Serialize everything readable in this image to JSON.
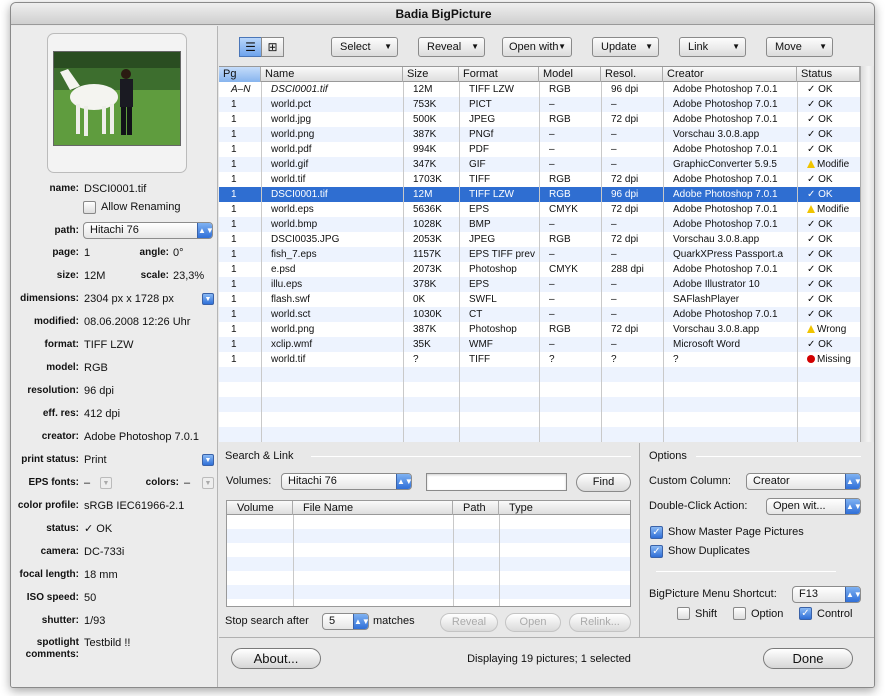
{
  "window": {
    "title": "Badia BigPicture"
  },
  "info": {
    "name_label": "name:",
    "name": "DSCI0001.tif",
    "allow_renaming": "Allow Renaming",
    "path_label": "path:",
    "path": "Hitachi 76",
    "page_label": "page:",
    "page": "1",
    "angle_label": "angle:",
    "angle": "0°",
    "size_label": "size:",
    "size": "12M",
    "scale_label": "scale:",
    "scale": "23,3%",
    "dimensions_label": "dimensions:",
    "dimensions": "2304 px x 1728 px",
    "modified_label": "modified:",
    "modified": "08.06.2008 12:26 Uhr",
    "format_label": "format:",
    "format": "TIFF LZW",
    "model_label": "model:",
    "model": "RGB",
    "resolution_label": "resolution:",
    "resolution": "96 dpi",
    "effres_label": "eff. res:",
    "effres": "412 dpi",
    "creator_label": "creator:",
    "creator": "Adobe Photoshop 7.0.1",
    "printstatus_label": "print status:",
    "printstatus": "Print",
    "epsfonts_label": "EPS fonts:",
    "epsfonts": "–",
    "colors_label": "colors:",
    "colors": "–",
    "colorprofile_label": "color profile:",
    "colorprofile": "sRGB IEC61966-2.1",
    "status_label": "status:",
    "status": "✓ OK",
    "camera_label": "camera:",
    "camera": "DC-733i",
    "focal_label": "focal length:",
    "focal": "18 mm",
    "iso_label": "ISO speed:",
    "iso": "50",
    "shutter_label": "shutter:",
    "shutter": "1/93",
    "spotlight_label1": "spotlight",
    "spotlight_label2": "comments:",
    "spotlight": "Testbild !!"
  },
  "toolbar": {
    "select": "Select",
    "reveal": "Reveal",
    "openwith": "Open with",
    "update": "Update",
    "link": "Link",
    "move": "Move",
    "list_icon": "list-view-icon",
    "grid_icon": "grid-view-icon"
  },
  "table": {
    "headers": [
      "Pg",
      "Name",
      "Size",
      "Format",
      "Model",
      "Resol.",
      "Creator",
      "Status"
    ],
    "rows": [
      {
        "pg": "A–N",
        "name": "DSCI0001.tif",
        "size": "12M",
        "format": "TIFF LZW",
        "model": "RGB",
        "res": "96 dpi",
        "creator": "Adobe Photoshop 7.0.1",
        "status": "✓ OK",
        "italic": true
      },
      {
        "pg": "1",
        "name": "world.pct",
        "size": "753K",
        "format": "PICT",
        "model": "–",
        "res": "–",
        "creator": "Adobe Photoshop 7.0.1",
        "status": "✓ OK"
      },
      {
        "pg": "1",
        "name": "world.jpg",
        "size": "500K",
        "format": "JPEG",
        "model": "RGB",
        "res": "72 dpi",
        "creator": "Adobe Photoshop 7.0.1",
        "status": "✓ OK"
      },
      {
        "pg": "1",
        "name": "world.png",
        "size": "387K",
        "format": "PNGf",
        "model": "–",
        "res": "–",
        "creator": "Vorschau 3.0.8.app",
        "status": "✓ OK"
      },
      {
        "pg": "1",
        "name": "world.pdf",
        "size": "994K",
        "format": "PDF",
        "model": "–",
        "res": "–",
        "creator": "Adobe Photoshop 7.0.1",
        "status": "✓ OK"
      },
      {
        "pg": "1",
        "name": "world.gif",
        "size": "347K",
        "format": "GIF",
        "model": "–",
        "res": "–",
        "creator": "GraphicConverter 5.9.5",
        "status": "Modifie",
        "warn": true
      },
      {
        "pg": "1",
        "name": "world.tif",
        "size": "1703K",
        "format": "TIFF",
        "model": "RGB",
        "res": "72 dpi",
        "creator": "Adobe Photoshop 7.0.1",
        "status": "✓ OK"
      },
      {
        "pg": "1",
        "name": "DSCI0001.tif",
        "size": "12M",
        "format": "TIFF LZW",
        "model": "RGB",
        "res": "96 dpi",
        "creator": "Adobe Photoshop 7.0.1",
        "status": "✓ OK",
        "selected": true
      },
      {
        "pg": "1",
        "name": "world.eps",
        "size": "5636K",
        "format": "EPS",
        "model": "CMYK",
        "res": "72 dpi",
        "creator": "Adobe Photoshop 7.0.1",
        "status": "Modifie",
        "warn": true
      },
      {
        "pg": "1",
        "name": "world.bmp",
        "size": "1028K",
        "format": "BMP",
        "model": "–",
        "res": "–",
        "creator": "Adobe Photoshop 7.0.1",
        "status": "✓ OK"
      },
      {
        "pg": "1",
        "name": "DSCI0035.JPG",
        "size": "2053K",
        "format": "JPEG",
        "model": "RGB",
        "res": "72 dpi",
        "creator": "Vorschau 3.0.8.app",
        "status": "✓ OK"
      },
      {
        "pg": "1",
        "name": "fish_7.eps",
        "size": "1157K",
        "format": "EPS TIFF prev",
        "model": "–",
        "res": "–",
        "creator": "QuarkXPress Passport.a",
        "status": "✓ OK"
      },
      {
        "pg": "1",
        "name": "e.psd",
        "size": "2073K",
        "format": "Photoshop",
        "model": "CMYK",
        "res": "288 dpi",
        "creator": "Adobe Photoshop 7.0.1",
        "status": "✓ OK"
      },
      {
        "pg": "1",
        "name": "illu.eps",
        "size": "378K",
        "format": "EPS",
        "model": "–",
        "res": "–",
        "creator": "Adobe Illustrator 10",
        "status": "✓ OK"
      },
      {
        "pg": "1",
        "name": "flash.swf",
        "size": "0K",
        "format": "SWFL",
        "model": "–",
        "res": "–",
        "creator": "SAFlashPlayer",
        "status": "✓ OK"
      },
      {
        "pg": "1",
        "name": "world.sct",
        "size": "1030K",
        "format": "CT",
        "model": "–",
        "res": "–",
        "creator": "Adobe Photoshop 7.0.1",
        "status": "✓ OK"
      },
      {
        "pg": "1",
        "name": "world.png",
        "size": "387K",
        "format": "Photoshop",
        "model": "RGB",
        "res": "72 dpi",
        "creator": "Vorschau 3.0.8.app",
        "status": "Wrong",
        "warn": true
      },
      {
        "pg": "1",
        "name": "xclip.wmf",
        "size": "35K",
        "format": "WMF",
        "model": "–",
        "res": "–",
        "creator": "Microsoft Word",
        "status": "✓ OK"
      },
      {
        "pg": "1",
        "name": "world.tif",
        "size": "?",
        "format": "TIFF",
        "model": "?",
        "res": "?",
        "creator": "?",
        "status": "Missing",
        "missing": true
      }
    ]
  },
  "search": {
    "title": "Search & Link",
    "volumes_label": "Volumes:",
    "volume": "Hitachi 76",
    "query": "",
    "find": "Find",
    "headers": [
      "Volume",
      "File Name",
      "Path",
      "Type"
    ],
    "stop_label": "Stop search after",
    "stop_value": "5",
    "matches": "matches",
    "reveal": "Reveal",
    "open": "Open",
    "relink": "Relink..."
  },
  "options": {
    "title": "Options",
    "custom_label": "Custom Column:",
    "custom_value": "Creator",
    "dbl_label": "Double-Click Action:",
    "dbl_value": "Open wit...",
    "master": "Show Master Page Pictures",
    "duplicates": "Show Duplicates",
    "shortcut_label": "BigPicture Menu Shortcut:",
    "shortcut_value": "F13",
    "shift": "Shift",
    "option": "Option",
    "control": "Control"
  },
  "footer": {
    "about": "About...",
    "status": "Displaying 19 pictures; 1 selected",
    "done": "Done"
  },
  "colors": {
    "selection": "#2f6ed1",
    "accent": "#3070d8",
    "warn": "#f0c400",
    "missing": "#d20000"
  }
}
